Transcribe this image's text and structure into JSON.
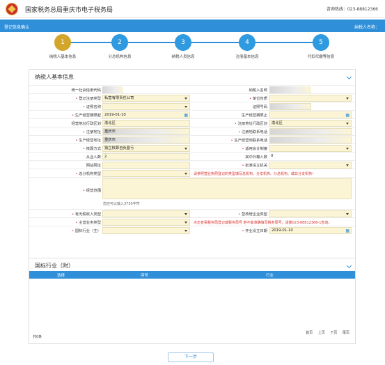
{
  "header": {
    "title": "国家税务总局重庆市电子税务局",
    "hotline": "咨询热线：023-88812366"
  },
  "bar": {
    "left": "登记信息确认",
    "right": "纳税人名称："
  },
  "steps": [
    {
      "num": "1",
      "label": "纳税人基本信息"
    },
    {
      "num": "2",
      "label": "分总机构信息"
    },
    {
      "num": "3",
      "label": "纳税人员信息"
    },
    {
      "num": "4",
      "label": "注册基本信息"
    },
    {
      "num": "5",
      "label": "代扣代缴等信息"
    }
  ],
  "panel": {
    "title": "纳税人基本信息",
    "f": {
      "tyshxydm": "统一社会信用代码",
      "nsrmc": "纳税人名称",
      "djzclx": "登记注册类型",
      "djzclx_v": "私营有限责任公司",
      "dwxz": "单位性质",
      "zjmc": "证照名称",
      "zjhm": "证照号码",
      "scjyqx_q": "生产经营期限起",
      "scjyqx_q_v": "2019-01-10",
      "scjyqx_z": "生产经营期限止",
      "jydxzq": "经营地址行政区划",
      "jydxzq_v": "渝北区",
      "zcdxzq": "注册地址行政区划",
      "zcdxzq_v": "渝北区",
      "zcdz": "注册地址",
      "zcdz_v": "重庆市",
      "zcdlxdh": "注册地联系电话",
      "scjydz": "生产经营地址",
      "scjydz_v": "重庆市",
      "scjydlxdh": "生产经营地联系电话",
      "hsfs": "核算方式",
      "hsfs_v": "独立核算自负盈亏",
      "cyzd": "适用会计制度",
      "cyrs": "从业人数",
      "cyrs_v": "2",
      "wjrs": "其中外籍人数",
      "wjrs_v": "0",
      "wz": "网站网址",
      "gkjg": "批准设立机关",
      "zfjglx": "总分机构类型",
      "zfjglx_note": "请参照营业执照登记的类型填写总机构、分支机构、分总机构、或非分支机构！",
      "jyfw": "经营范围",
      "jyfw_count": "您还可以输入3750字符",
      "yswgsrlx": "有无税收入类型",
      "ygzyhy": "营改增企业类型",
      "zyywlx": "主营业务类型",
      "zyywlx_note": "点击查看税务局登记或税务局号 若不能准确填写税务局号，请拨023-88812366-1查询。",
      "gbhy": "国标行业（主）",
      "kysj": "开业设立日期",
      "kysj_v": "2019-01-10"
    }
  },
  "industry": {
    "title": "国标行业（附）",
    "cols": [
      "选择",
      "序号",
      "行业"
    ],
    "total": "共0条",
    "pager": [
      "首页",
      "上页",
      "下页",
      "尾页"
    ]
  },
  "next": "下一步"
}
